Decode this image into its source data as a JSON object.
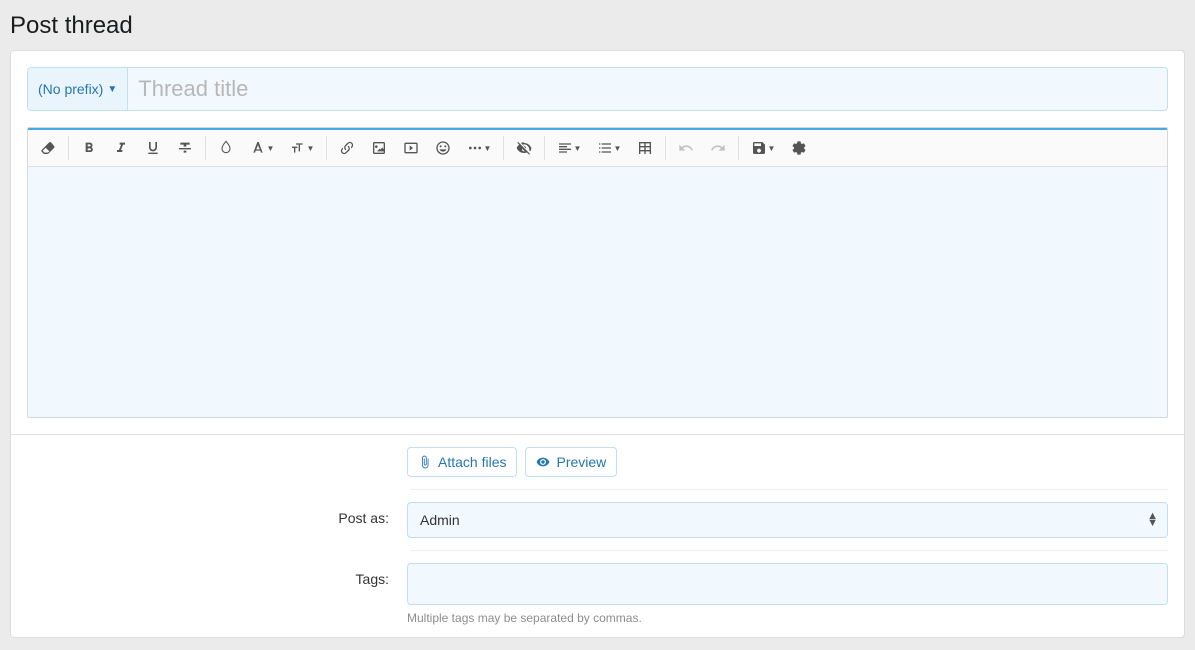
{
  "pageTitle": "Post thread",
  "prefix": {
    "label": "(No prefix)"
  },
  "titleField": {
    "placeholder": "Thread title",
    "value": ""
  },
  "toolbar": {
    "erase": "remove-formatting-icon",
    "bold": "bold-icon",
    "italic": "italic-icon",
    "underline": "underline-icon",
    "strike": "strikethrough-icon",
    "color": "text-color-icon",
    "font": "font-family-icon",
    "size": "font-size-icon",
    "link": "link-icon",
    "image": "image-icon",
    "media": "media-icon",
    "smile": "emoji-icon",
    "more": "more-icon",
    "spoiler": "spoiler-icon",
    "align": "align-icon",
    "list": "list-icon",
    "table": "table-icon",
    "undo": "undo-icon",
    "redo": "redo-icon",
    "drafts": "drafts-icon",
    "settings": "settings-icon"
  },
  "actions": {
    "attach": "Attach files",
    "preview": "Preview"
  },
  "postAs": {
    "label": "Post as:",
    "value": "Admin"
  },
  "tags": {
    "label": "Tags:",
    "hint": "Multiple tags may be separated by commas.",
    "value": ""
  }
}
